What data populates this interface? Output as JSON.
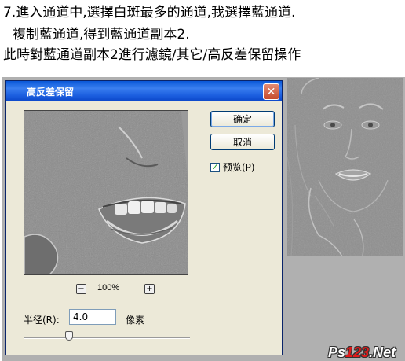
{
  "instructions": {
    "line1": "7.進入通道中,選擇白斑最多的通道,我選擇藍通道.",
    "line2": "複制藍通道,得到藍通道副本2.",
    "line3": "此時對藍通道副本2進行濾鏡/其它/高反差保留操作"
  },
  "dialog": {
    "title": "高反差保留",
    "close_symbol": "✕",
    "ok_label": "确定",
    "cancel_label": "取消",
    "preview_label": "预览(P)",
    "preview_checked": true,
    "zoom_level": "100%",
    "zoom_out_symbol": "−",
    "zoom_in_symbol": "+",
    "radius_label": "半径(R):",
    "radius_value": "4.0",
    "unit_label": "像素"
  },
  "watermark": {
    "prefix": "Ps",
    "number": "123",
    "suffix": ".Net"
  },
  "colors": {
    "titlebar": "#0a58d8",
    "dialog_bg": "#ece9d8",
    "close_button": "#c54a2c",
    "filtered_gray": "#8a8a8a"
  }
}
